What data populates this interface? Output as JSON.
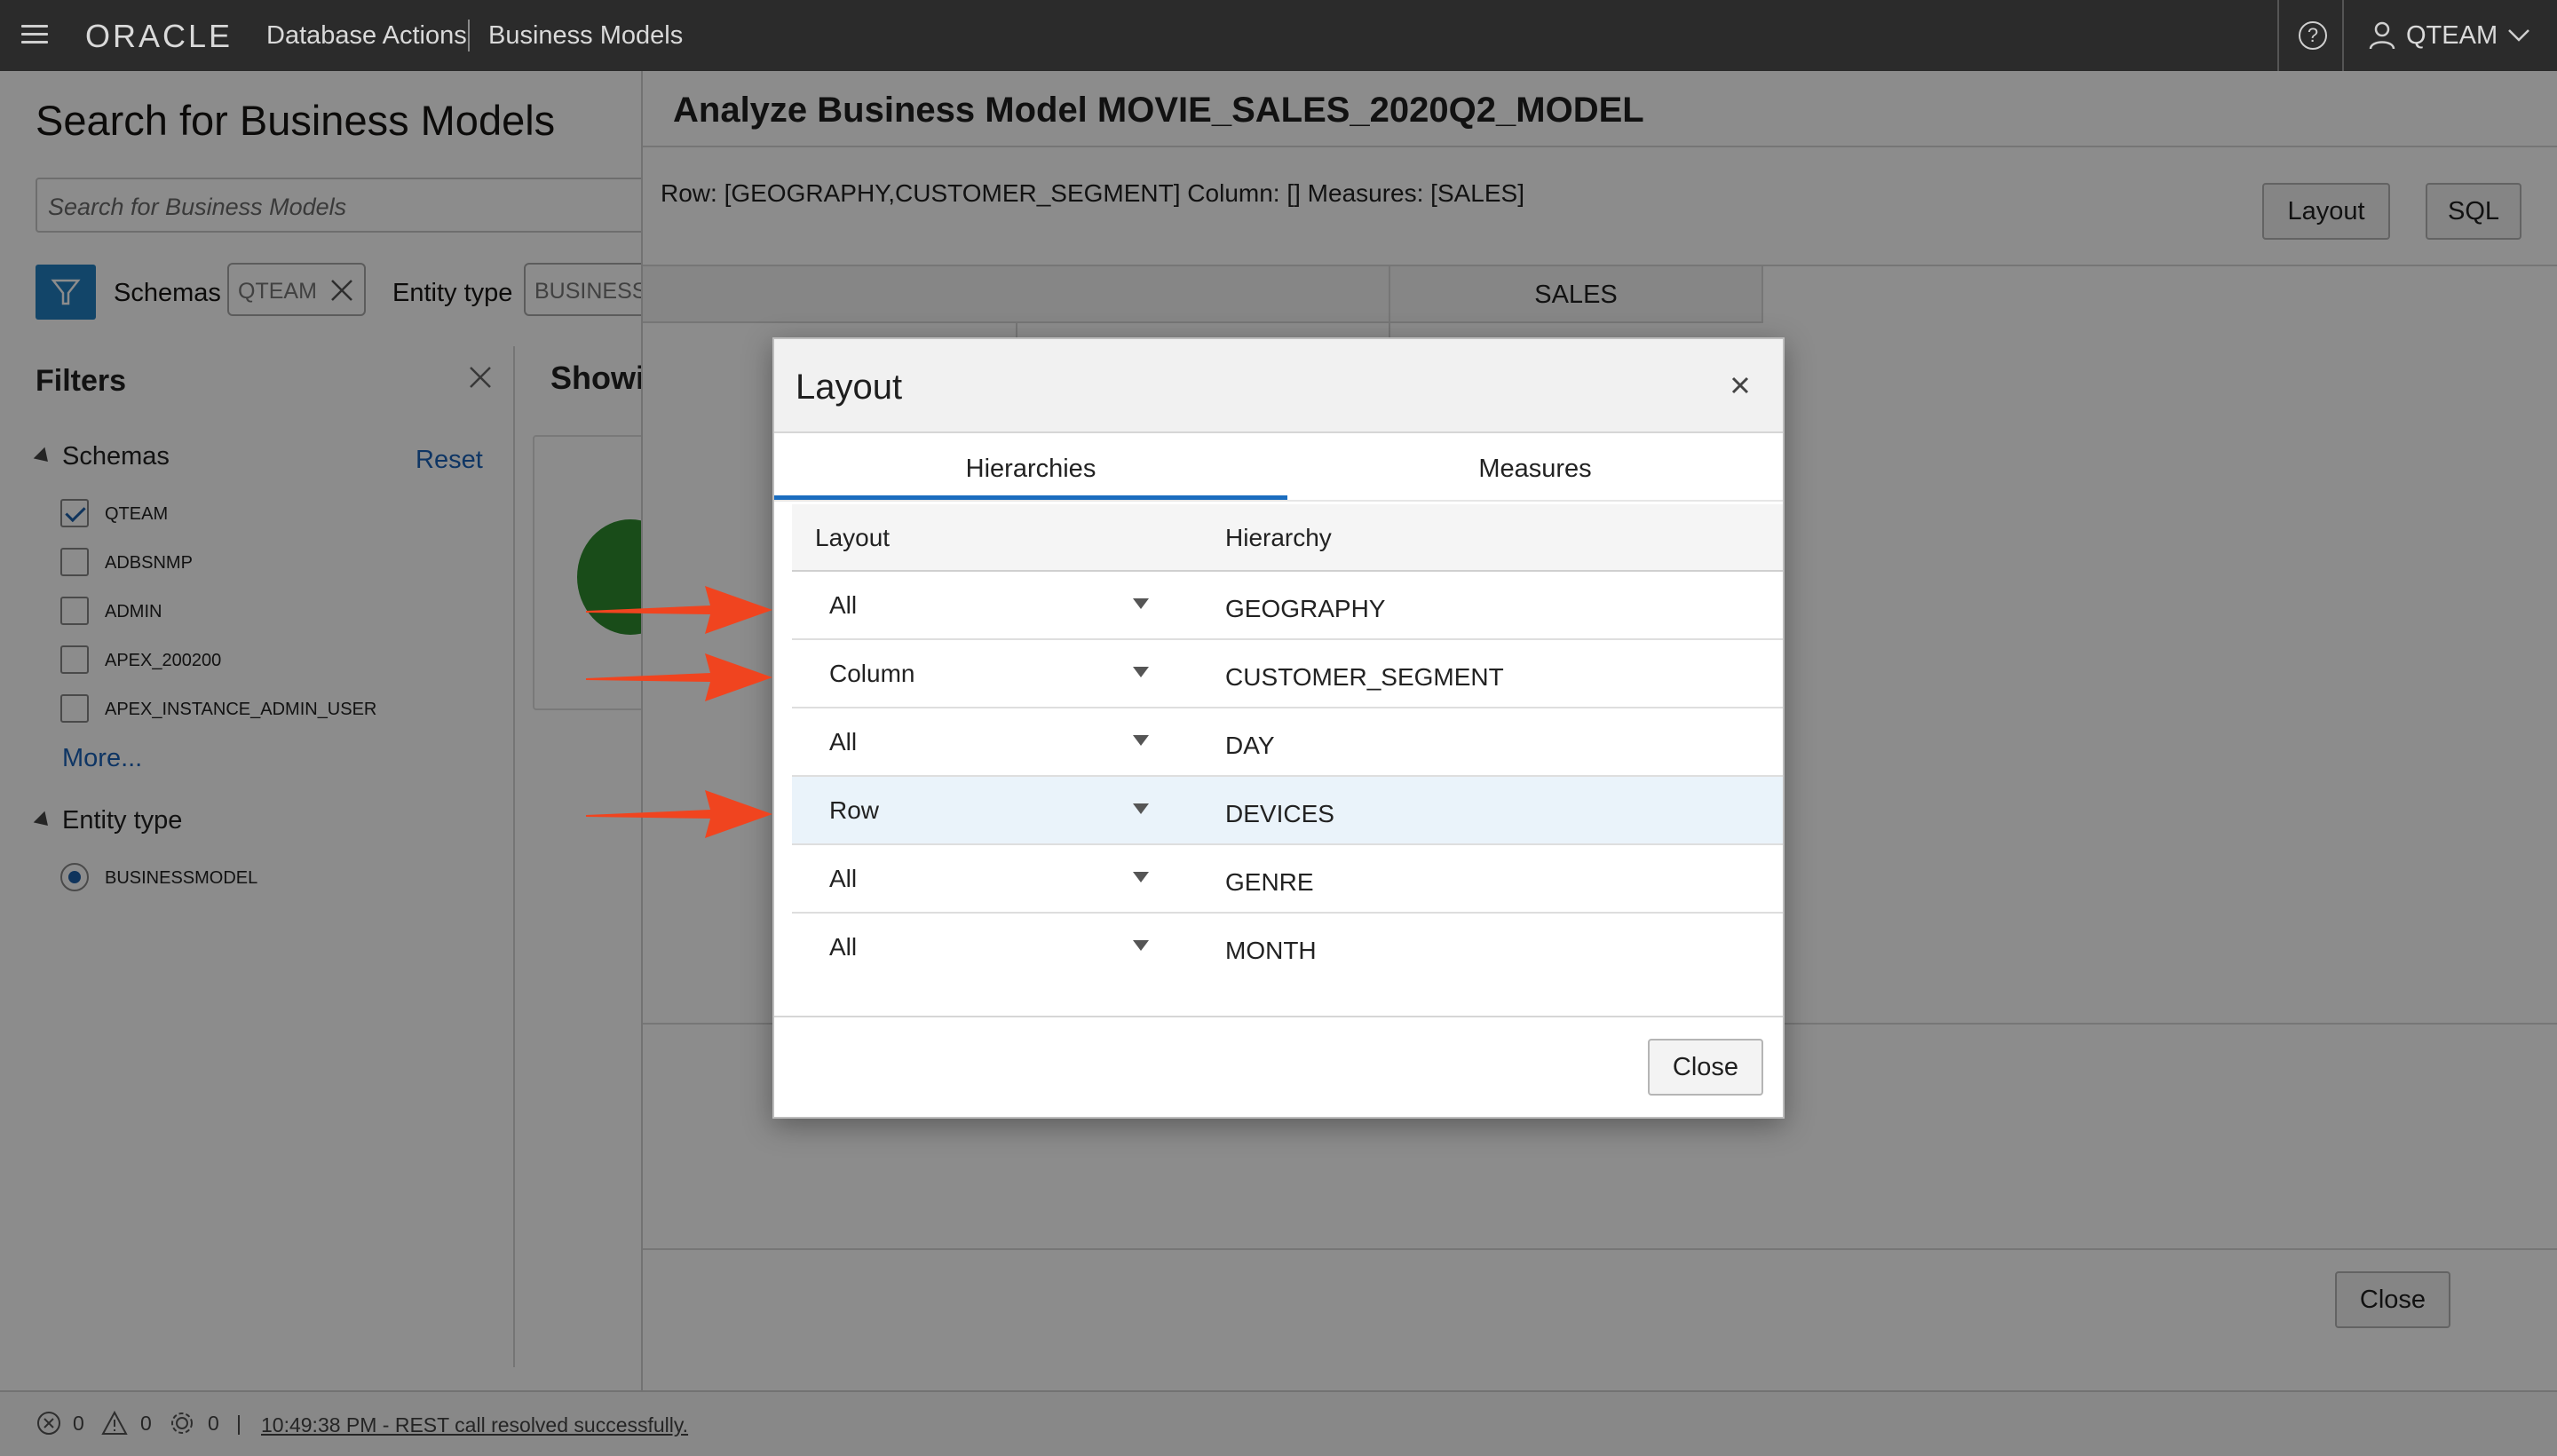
{
  "header": {
    "brand": "ORACLE",
    "app_name": "Database Actions",
    "page_name": "Business Models",
    "help_glyph": "?",
    "user": "QTEAM"
  },
  "search_page": {
    "title": "Search for Business Models",
    "search_placeholder": "Search for Business Models",
    "schemas_label": "Schemas",
    "schema_chip": "QTEAM",
    "entity_type_label": "Entity type",
    "entity_type_chip": "BUSINESS",
    "filters": {
      "title": "Filters",
      "schemas_section": "Schemas",
      "reset_label": "Reset",
      "schema_options": [
        {
          "label": "QTEAM",
          "checked": true
        },
        {
          "label": "ADBSNMP",
          "checked": false
        },
        {
          "label": "ADMIN",
          "checked": false
        },
        {
          "label": "APEX_200200",
          "checked": false
        },
        {
          "label": "APEX_INSTANCE_ADMIN_USER",
          "checked": false
        }
      ],
      "more_label": "More...",
      "entity_section": "Entity type",
      "entity_options": [
        {
          "label": "BUSINESSMODEL",
          "selected": true
        }
      ]
    },
    "showing_text": "Showi"
  },
  "analyze": {
    "title": "Analyze Business Model MOVIE_SALES_2020Q2_MODEL",
    "summary": "Row: [GEOGRAPHY,CUSTOMER_SEGMENT] Column: [] Measures: [SALES]",
    "layout_button": "Layout",
    "sql_button": "SQL",
    "grid_header": "SALES",
    "close_button": "Close"
  },
  "layout_dialog": {
    "title": "Layout",
    "close_glyph": "×",
    "tabs": [
      {
        "label": "Hierarchies",
        "active": true
      },
      {
        "label": "Measures",
        "active": false
      }
    ],
    "columns": {
      "layout": "Layout",
      "hierarchy": "Hierarchy"
    },
    "rows": [
      {
        "layout": "All",
        "hierarchy": "GEOGRAPHY",
        "selected": false
      },
      {
        "layout": "Column",
        "hierarchy": "CUSTOMER_SEGMENT",
        "selected": false
      },
      {
        "layout": "All",
        "hierarchy": "DAY",
        "selected": false
      },
      {
        "layout": "Row",
        "hierarchy": "DEVICES",
        "selected": true
      },
      {
        "layout": "All",
        "hierarchy": "GENRE",
        "selected": false
      },
      {
        "layout": "All",
        "hierarchy": "MONTH",
        "selected": false
      }
    ],
    "close_button": "Close"
  },
  "status_bar": {
    "errors": "0",
    "warnings": "0",
    "tasks": "0",
    "separator": "|",
    "message": "10:49:38 PM - REST call resolved successfully."
  },
  "colors": {
    "header_bg": "#2b2b2b",
    "accent_blue": "#1b6dbf",
    "annotation_red": "#f0441f",
    "selected_row": "#eaf3fa"
  }
}
